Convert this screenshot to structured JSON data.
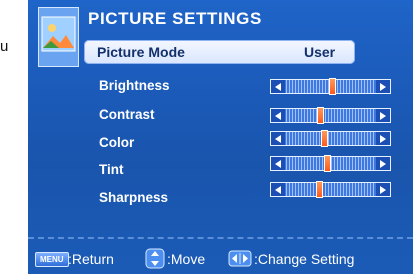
{
  "outside_char": "u",
  "menu": {
    "title": "PICTURE SETTINGS",
    "picture_mode": {
      "label": "Picture Mode",
      "value": "User"
    },
    "settings": [
      {
        "label": "Brightness",
        "level": 0.52
      },
      {
        "label": "Contrast",
        "level": 0.38
      },
      {
        "label": "Color",
        "level": 0.43
      },
      {
        "label": "Tint",
        "level": 0.46
      },
      {
        "label": "Sharpness",
        "level": 0.37
      }
    ]
  },
  "footer": {
    "menu_key": "MENU",
    "return_text": ":Return",
    "move_text": ":Move",
    "change_text": ":Change Setting"
  },
  "icons": {
    "thumb": "picture-settings-thumbnail-icon",
    "move": "up-down-arrows-icon",
    "change": "left-right-arrows-icon"
  },
  "colors": {
    "panel_bg": "#1b5ab8",
    "highlight_row": "#e6efff",
    "slider_knob": "#ff6a2a",
    "text": "#ffffff"
  }
}
